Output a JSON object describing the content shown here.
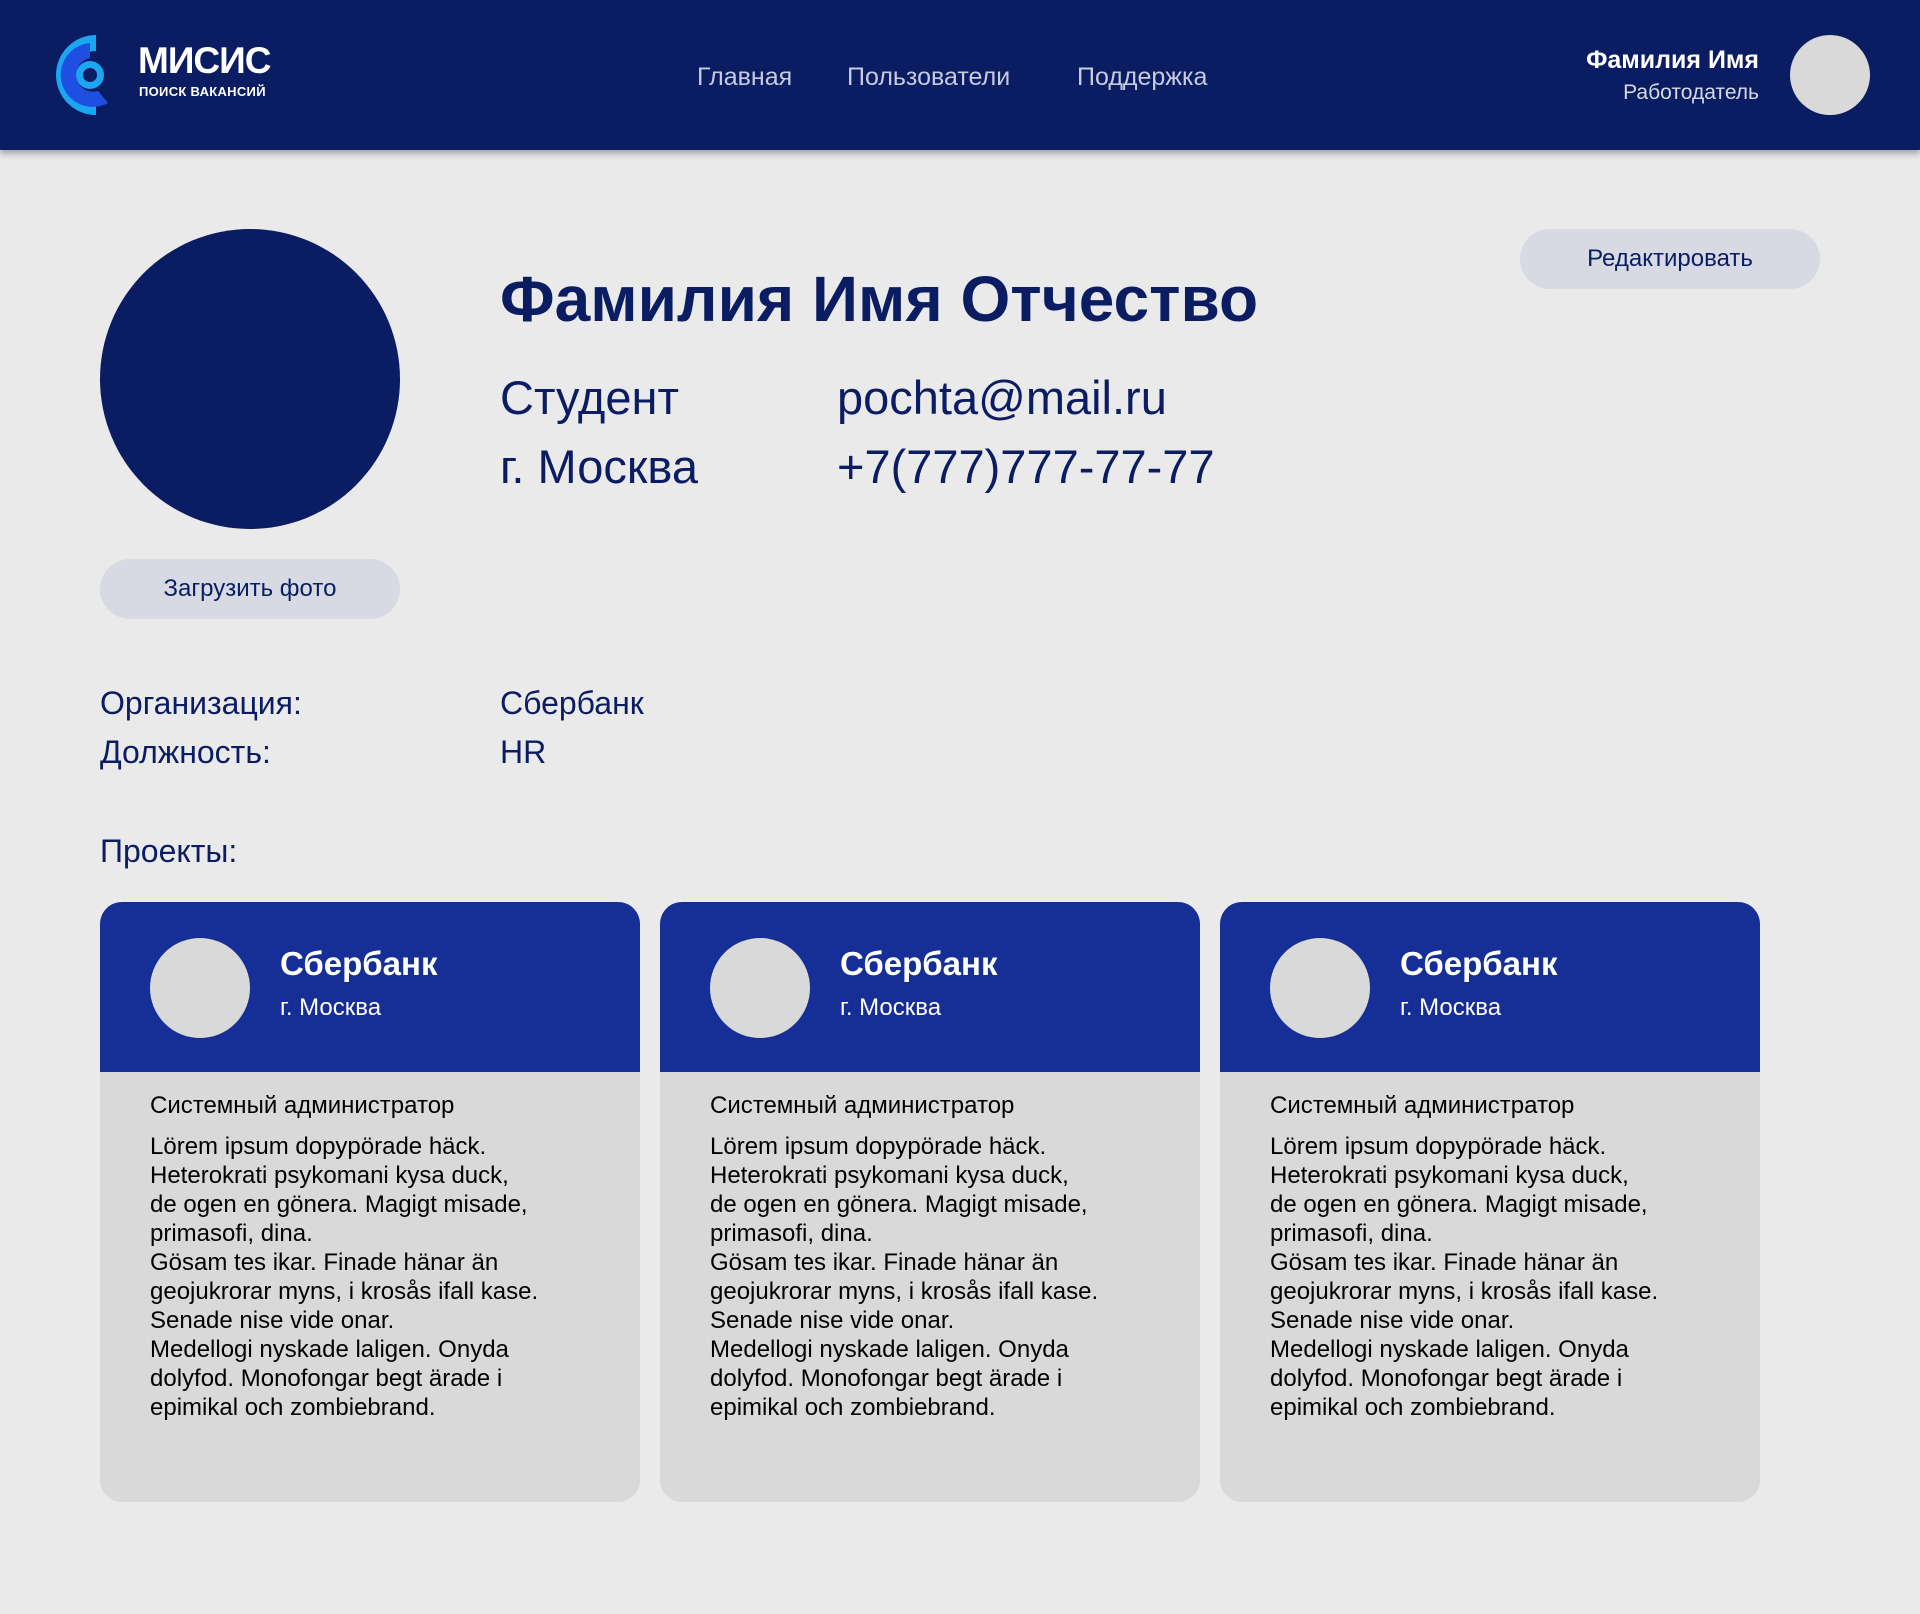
{
  "colors": {
    "brand_navy": "#0b1d62",
    "card_header_blue": "#162f96",
    "page_background": "#eaeaeb",
    "button_background": "#d7dae3",
    "placeholder_gray": "#d9d9d9"
  },
  "header": {
    "logo": {
      "name": "МИСИС",
      "subtitle": "ПОИСК ВАКАНСИЙ",
      "icon": "misis-logo-icon"
    },
    "nav": [
      "Главная",
      "Пользователи",
      "Поддержка"
    ],
    "user": {
      "name": "Фамилия Имя",
      "role": "Работодатель",
      "avatar_icon": "avatar-placeholder"
    }
  },
  "profile": {
    "full_name": "Фамилия Имя Отчество",
    "status": "Студент",
    "city": "г. Москва",
    "email": "pochta@mail.ru",
    "phone": "+7(777)777-77-77",
    "upload_photo_label": "Загрузить фото",
    "edit_label": "Редактировать"
  },
  "details": [
    {
      "label": "Организация:",
      "value": "Сбербанк"
    },
    {
      "label": "Должность:",
      "value": "HR"
    }
  ],
  "projects": {
    "heading": "Проекты:",
    "items": [
      {
        "company": "Сбербанк",
        "city": "г. Москва",
        "role": "Системный администратор",
        "description": [
          "Lörem ipsum dopypörade häck.",
          "Heterokrati psykomani kysa duck,",
          "de ogen en gönera. Magigt misade,",
          "primasofi, dina.",
          "Gösam tes ikar. Finade hänar än",
          "geojukrorar myns, i krosås ifall kase.",
          "Senade nise vide onar.",
          "Medellogi nyskade laligen. Onyda",
          "dolyfod. Monofongar begt ärade i",
          "epimikal och zombiebrand."
        ]
      },
      {
        "company": "Сбербанк",
        "city": "г. Москва",
        "role": "Системный администратор",
        "description": [
          "Lörem ipsum dopypörade häck.",
          "Heterokrati psykomani kysa duck,",
          "de ogen en gönera. Magigt misade,",
          "primasofi, dina.",
          "Gösam tes ikar. Finade hänar än",
          "geojukrorar myns, i krosås ifall kase.",
          "Senade nise vide onar.",
          "Medellogi nyskade laligen. Onyda",
          "dolyfod. Monofongar begt ärade i",
          "epimikal och zombiebrand."
        ]
      },
      {
        "company": "Сбербанк",
        "city": "г. Москва",
        "role": "Системный администратор",
        "description": [
          "Lörem ipsum dopypörade häck.",
          "Heterokrati psykomani kysa duck,",
          "de ogen en gönera. Magigt misade,",
          "primasofi, dina.",
          "Gösam tes ikar. Finade hänar än",
          "geojukrorar myns, i krosås ifall kase.",
          "Senade nise vide onar.",
          "Medellogi nyskade laligen. Onyda",
          "dolyfod. Monofongar begt ärade i",
          "epimikal och zombiebrand."
        ]
      }
    ]
  }
}
